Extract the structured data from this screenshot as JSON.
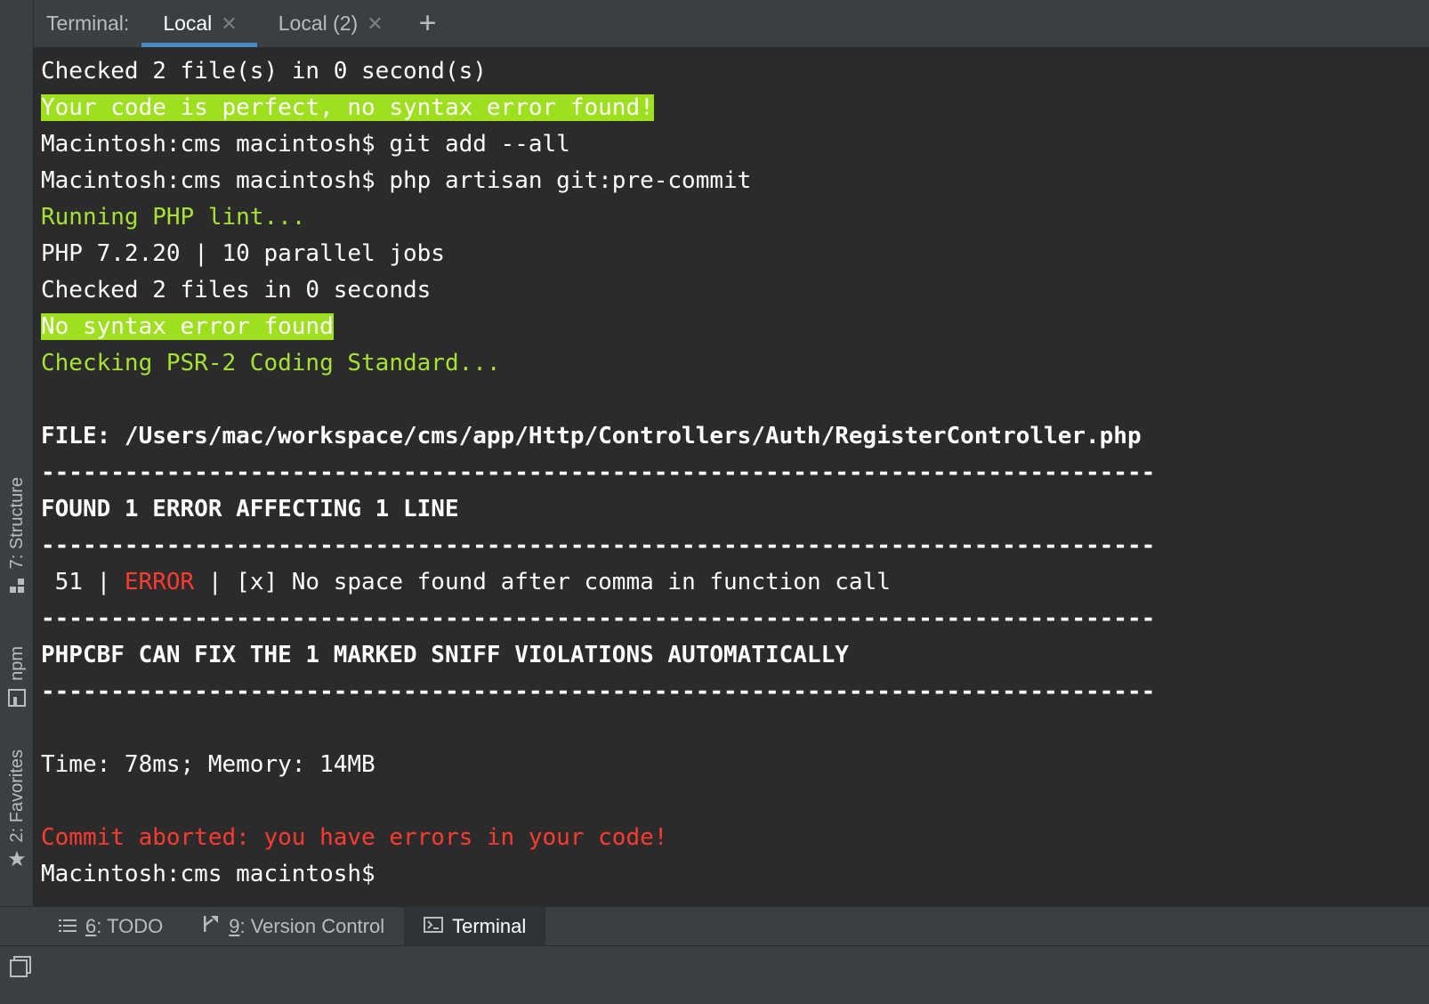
{
  "left_strip": {
    "structure_label": "7: Structure",
    "structure_icon": "structure-icon",
    "npm_label": "npm",
    "npm_icon": "npm-icon",
    "favorites_label": "2: Favorites",
    "favorites_icon": "star-icon"
  },
  "terminal_header": {
    "title": "Terminal:",
    "tabs": [
      {
        "label": "Local",
        "active": true
      },
      {
        "label": "Local (2)",
        "active": false
      }
    ],
    "add_icon": "plus-icon"
  },
  "terminal_lines": {
    "l1": "Checked 2 file(s) in 0 second(s)",
    "l2": "Your code is perfect, no syntax error found!",
    "l3": "Macintosh:cms macintosh$ git add --all",
    "l4": "Macintosh:cms macintosh$ php artisan git:pre-commit",
    "l5": "Running PHP lint...",
    "l6": "PHP 7.2.20 | 10 parallel jobs",
    "l7": "Checked 2 files in 0 seconds",
    "l8": "No syntax error found",
    "l9": "Checking PSR-2 Coding Standard...",
    "l10": "FILE: /Users/mac/workspace/cms/app/Http/Controllers/Auth/RegisterController.php",
    "separator": "--------------------------------------------------------------------------------",
    "l11": "FOUND 1 ERROR AFFECTING 1 LINE",
    "error_line_no": " 51 | ",
    "error_level": "ERROR",
    "error_msg": " | [x] No space found after comma in function call",
    "l13": "PHPCBF CAN FIX THE 1 MARKED SNIFF VIOLATIONS AUTOMATICALLY",
    "l14": "Time: 78ms; Memory: 14MB",
    "l15": "Commit aborted: you have errors in your code!",
    "prompt": "Macintosh:cms macintosh$"
  },
  "bottom_bar": {
    "todo_num": "6",
    "todo_label": ": TODO",
    "vc_num": "9",
    "vc_label": ": Version Control",
    "terminal_label": "Terminal"
  },
  "colors": {
    "highlight_green": "#9ee01e",
    "text_green": "#a5e234",
    "error_red": "#ff3b30",
    "tab_underline": "#4a88c7",
    "terminal_bg": "#2b2b2b",
    "chrome_bg": "#3c3f41"
  }
}
